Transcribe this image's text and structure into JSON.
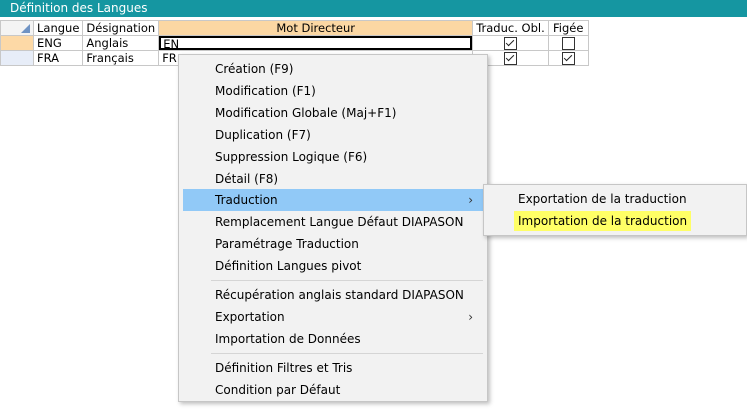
{
  "window": {
    "title": "Définition des Langues"
  },
  "grid": {
    "columns": [
      "Langue",
      "Désignation",
      "Mot Directeur",
      "Traduc. Obl.",
      "Figée"
    ],
    "rows": [
      {
        "langue": "ENG",
        "designation": "Anglais",
        "mot_directeur": "EN",
        "traduc_obl": true,
        "figee": false
      },
      {
        "langue": "FRA",
        "designation": "Français",
        "mot_directeur": "FR",
        "traduc_obl": true,
        "figee": true
      }
    ]
  },
  "context_menu": {
    "items": [
      "Création (F9)",
      "Modification (F1)",
      "Modification Globale (Maj+F1)",
      "Duplication (F7)",
      "Suppression Logique (F6)",
      "Détail (F8)",
      "Traduction",
      "Remplacement Langue Défaut DIAPASON",
      "Paramétrage Traduction",
      "Définition Langues pivot",
      "Récupération anglais standard DIAPASON",
      "Exportation",
      "Importation de Données",
      "Définition Filtres et Tris",
      "Condition par Défaut"
    ],
    "highlighted": "Traduction",
    "submenu_arrow": "›"
  },
  "submenu": {
    "items": [
      "Exportation de la traduction",
      "Importation de la traduction"
    ],
    "highlighted": "Importation de la traduction"
  },
  "colors": {
    "titlebar": "#1596a1",
    "menu_highlight": "#91c9f7",
    "submenu_highlight": "#ffff66",
    "selected_column_header": "#fbd7a3"
  }
}
